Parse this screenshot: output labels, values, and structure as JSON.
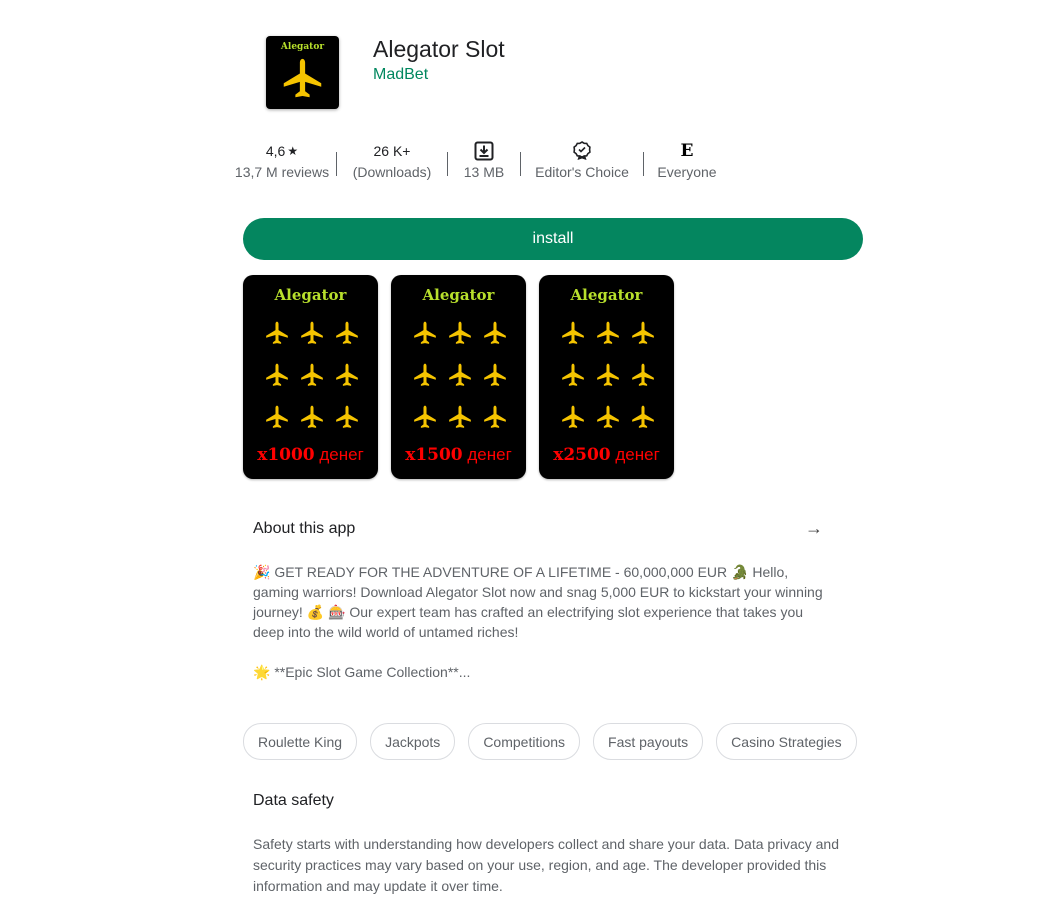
{
  "app": {
    "icon_label": "Alegator",
    "title": "Alegator Slot",
    "developer": "MadBet"
  },
  "stats": [
    {
      "top": "4,6",
      "top_icon": "star-icon",
      "bottom": "13,7 M reviews"
    },
    {
      "top": "26 K+",
      "bottom": "(Downloads)"
    },
    {
      "top_icon": "download-icon",
      "bottom": "13 MB"
    },
    {
      "top_icon": "editors-choice-icon",
      "bottom": "Editor's Choice"
    },
    {
      "top_icon": "rating-everyone-icon",
      "top": "E",
      "bottom": "Everyone"
    }
  ],
  "install_label": "install",
  "screenshots": [
    {
      "title": "Alegator",
      "multiplier": "x1000",
      "suffix": "денег"
    },
    {
      "title": "Alegator",
      "multiplier": "x1500",
      "suffix": "денег"
    },
    {
      "title": "Alegator",
      "multiplier": "x2500",
      "suffix": "денег"
    }
  ],
  "about": {
    "heading": "About this app",
    "arrow_icon": "arrow-right-icon",
    "para1": "🎉 GET READY FOR THE ADVENTURE OF A LIFETIME - 60,000,000 EUR 🐊 Hello, gaming warriors! Download Alegator Slot now and snag 5,000 EUR to kickstart your winning journey! 💰 🎰 Our expert team has crafted an electrifying slot experience that takes you deep into the wild world of untamed riches!",
    "para2": "🌟 **Epic Slot Game Collection**..."
  },
  "chips": [
    "Roulette King",
    "Jackpots",
    "Competitions",
    "Fast payouts",
    "Casino Strategies"
  ],
  "data_safety": {
    "heading": "Data safety",
    "text": "Safety starts with understanding how developers collect and share your data. Data privacy and security practices may vary based on your use, region, and age. The developer provided this information and may update it over time."
  },
  "colors": {
    "accent": "#01875f",
    "install_bg": "#04865f",
    "screenshot_title": "#b8e02c",
    "multiplier": "#ff0000",
    "plane": "#f5c400"
  }
}
